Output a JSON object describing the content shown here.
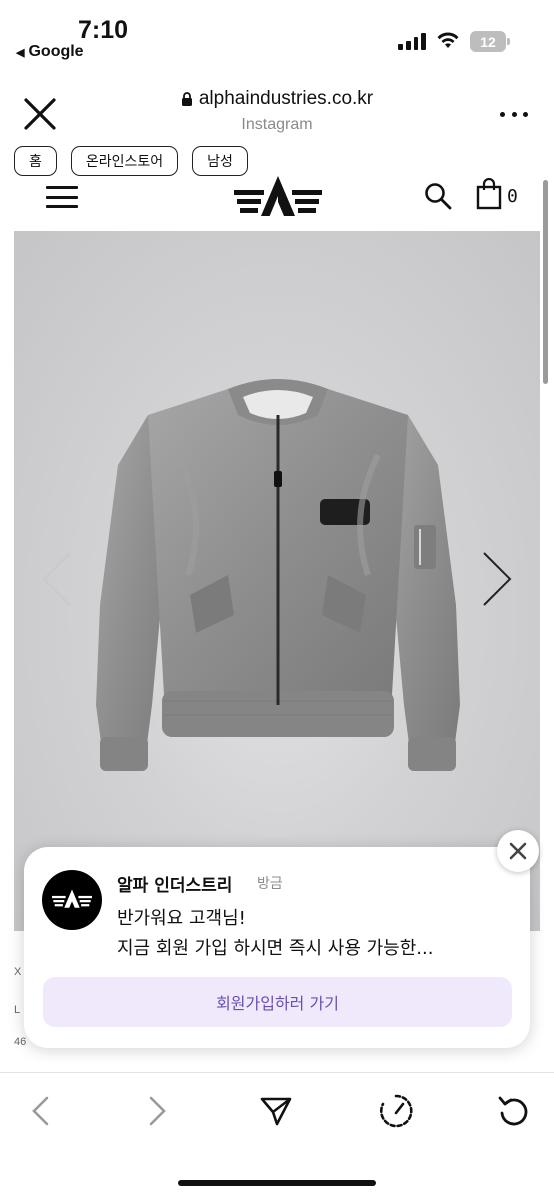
{
  "status_bar": {
    "time": "7:10",
    "back_app": "Google",
    "battery": "12"
  },
  "browser": {
    "url": "alphaindustries.co.kr",
    "subtitle": "Instagram"
  },
  "breadcrumb": [
    "홈",
    "온라인스토어",
    "남성"
  ],
  "site_header": {
    "cart_count": "0"
  },
  "product": {
    "image_alt": "gray bomber jacket",
    "partial_lines": [
      "X",
      "L",
      "46"
    ]
  },
  "notification": {
    "sender": "알파 인더스트리",
    "time_ago": "방금",
    "line1": "반가워요 고객님!",
    "line2": "지금 회원 가입 하시면 즉시 사용 가능한...",
    "cta": "회원가입하러 가기"
  },
  "colors": {
    "cta_bg": "#efe9fb",
    "cta_text": "#6b4fb0",
    "image_bg": "#d2d2d4"
  }
}
